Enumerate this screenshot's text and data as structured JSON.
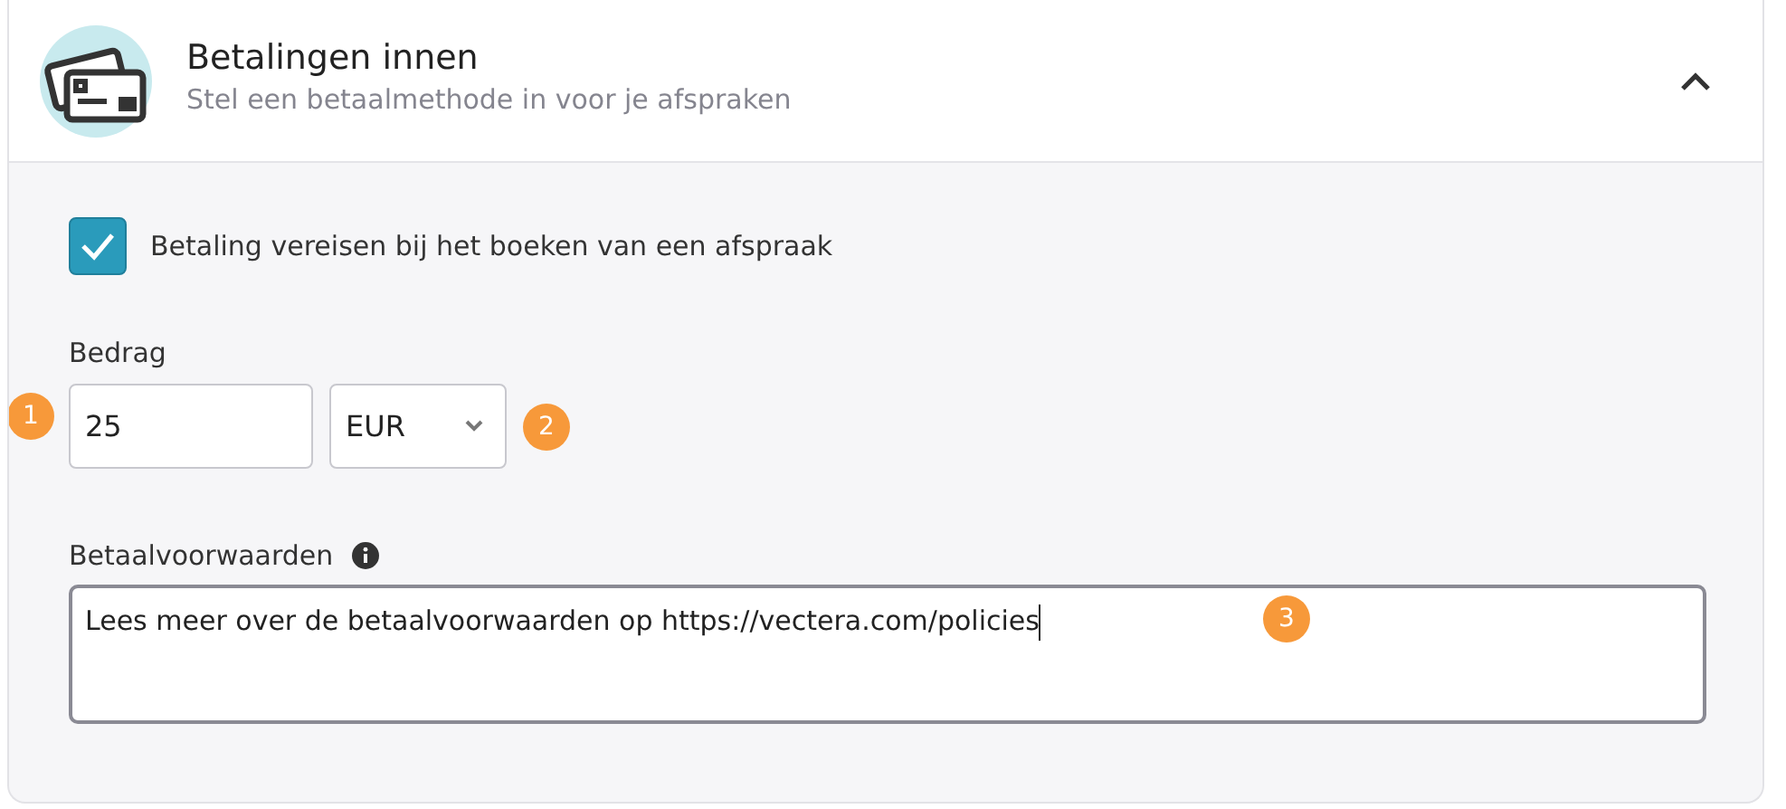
{
  "section": {
    "title": "Betalingen innen",
    "subtitle": "Stel een betaalmethode in voor je afspraken",
    "expanded": true
  },
  "require_payment": {
    "label": "Betaling vereisen bij het boeken van een afspraak",
    "checked": true
  },
  "amount": {
    "label": "Bedrag",
    "value": "25",
    "marker": "1"
  },
  "currency": {
    "value": "EUR",
    "marker": "2"
  },
  "terms": {
    "label": "Betaalvoorwaarden",
    "value": "Lees meer over de betaalvoorwaarden op https://vectera.com/policies",
    "marker": "3"
  }
}
